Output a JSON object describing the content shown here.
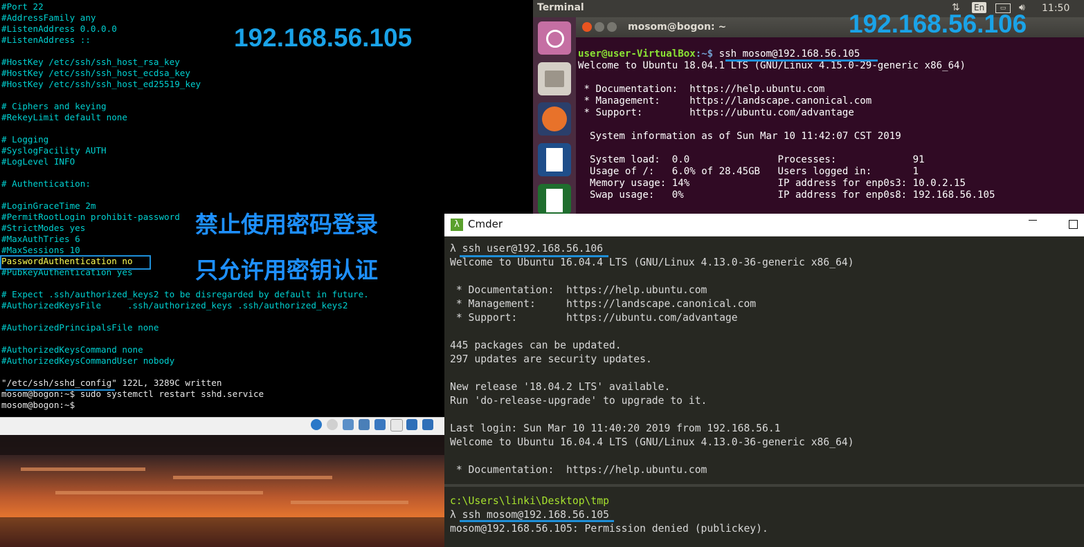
{
  "vm_console": {
    "lines": [
      "#Port 22",
      "#AddressFamily any",
      "#ListenAddress 0.0.0.0",
      "#ListenAddress ::",
      "",
      "#HostKey /etc/ssh/ssh_host_rsa_key",
      "#HostKey /etc/ssh/ssh_host_ecdsa_key",
      "#HostKey /etc/ssh/ssh_host_ed25519_key",
      "",
      "# Ciphers and keying",
      "#RekeyLimit default none",
      "",
      "# Logging",
      "#SyslogFacility AUTH",
      "#LogLevel INFO",
      "",
      "# Authentication:",
      "",
      "#LoginGraceTime 2m",
      "#PermitRootLogin prohibit-password",
      "#StrictModes yes",
      "#MaxAuthTries 6",
      "#MaxSessions 10",
      "PasswordAuthentication no",
      "#PubkeyAuthentication yes",
      "",
      "# Expect .ssh/authorized_keys2 to be disregarded by default in future.",
      "#AuthorizedKeysFile     .ssh/authorized_keys .ssh/authorized_keys2",
      "",
      "#AuthorizedPrincipalsFile none",
      "",
      "#AuthorizedKeysCommand none",
      "#AuthorizedKeysCommandUser nobody",
      "",
      "\"/etc/ssh/sshd_config\" 122L, 3289C written",
      "mosom@bogon:~$ sudo systemctl restart sshd.service",
      "mosom@bogon:~$ "
    ],
    "ip_annotation": "192.168.56.105",
    "annotation_line1": "禁止使用密码登录",
    "annotation_line2": "只允许用密钥认证"
  },
  "ubuntu": {
    "topbar_title": "Terminal",
    "input_lang": "En",
    "clock": "11:50",
    "window_title": "mosom@bogon: ~",
    "ip_annotation": "192.168.56.106",
    "prompt_user": "user@user-VirtualBox",
    "prompt_path": ":~$ ",
    "command": "ssh mosom@192.168.56.105",
    "lines": [
      "Welcome to Ubuntu 18.04.1 LTS (GNU/Linux 4.15.0-29-generic x86_64)",
      "",
      " * Documentation:  https://help.ubuntu.com",
      " * Management:     https://landscape.canonical.com",
      " * Support:        https://ubuntu.com/advantage",
      "",
      "  System information as of Sun Mar 10 11:42:07 CST 2019",
      "",
      "  System load:  0.0               Processes:             91",
      "  Usage of /:   6.0% of 28.45GB   Users logged in:       1",
      "  Memory usage: 14%               IP address for enp0s3: 10.0.2.15",
      "  Swap usage:   0%                IP address for enp0s8: 192.168.56.105"
    ]
  },
  "cmder": {
    "title": "Cmder",
    "lines": [
      "λ ssh user@192.168.56.106",
      "Welcome to Ubuntu 16.04.4 LTS (GNU/Linux 4.13.0-36-generic x86_64)",
      "",
      " * Documentation:  https://help.ubuntu.com",
      " * Management:     https://landscape.canonical.com",
      " * Support:        https://ubuntu.com/advantage",
      "",
      "445 packages can be updated.",
      "297 updates are security updates.",
      "",
      "New release '18.04.2 LTS' available.",
      "Run 'do-release-upgrade' to upgrade to it.",
      "",
      "Last login: Sun Mar 10 11:40:20 2019 from 192.168.56.1",
      "Welcome to Ubuntu 16.04.4 LTS (GNU/Linux 4.13.0-36-generic x86_64)",
      "",
      " * Documentation:  https://help.ubuntu.com"
    ],
    "bottom_path": "c:\\Users\\linki\\Desktop\\tmp",
    "bottom_cmd": "λ ssh mosom@192.168.56.105",
    "bottom_result": "mosom@192.168.56.105: Permission denied (publickey)."
  },
  "colors": {
    "console_text": "#00d0d0",
    "highlight_text": "#ffff55",
    "annotation_blue": "#1e8fd8",
    "ubuntu_bg": "#300a24",
    "cmder_bg": "#272822"
  }
}
